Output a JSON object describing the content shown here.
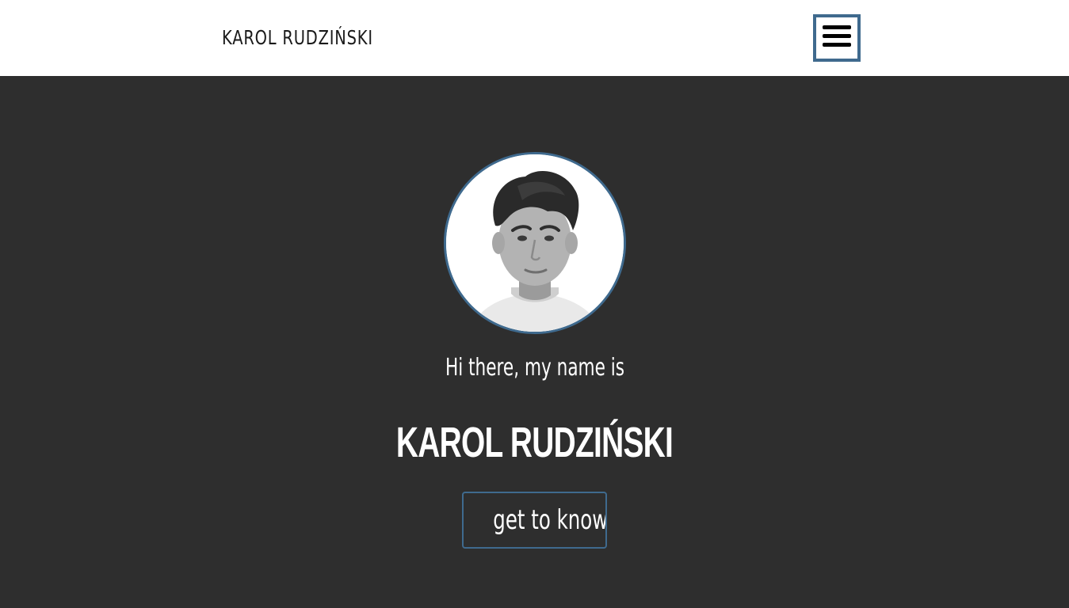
{
  "header": {
    "brand": "KAROL RUDZIŃSKI",
    "menu_icon": "hamburger-menu-icon",
    "accent_color": "#3f6a8e"
  },
  "hero": {
    "avatar_icon": "profile-photo",
    "greeting": "Hi there, my name is",
    "name": "KAROL RUDZIŃSKI",
    "cta_label": "get to know me",
    "background_color": "#2e2e2e",
    "text_color": "#ffffff"
  }
}
